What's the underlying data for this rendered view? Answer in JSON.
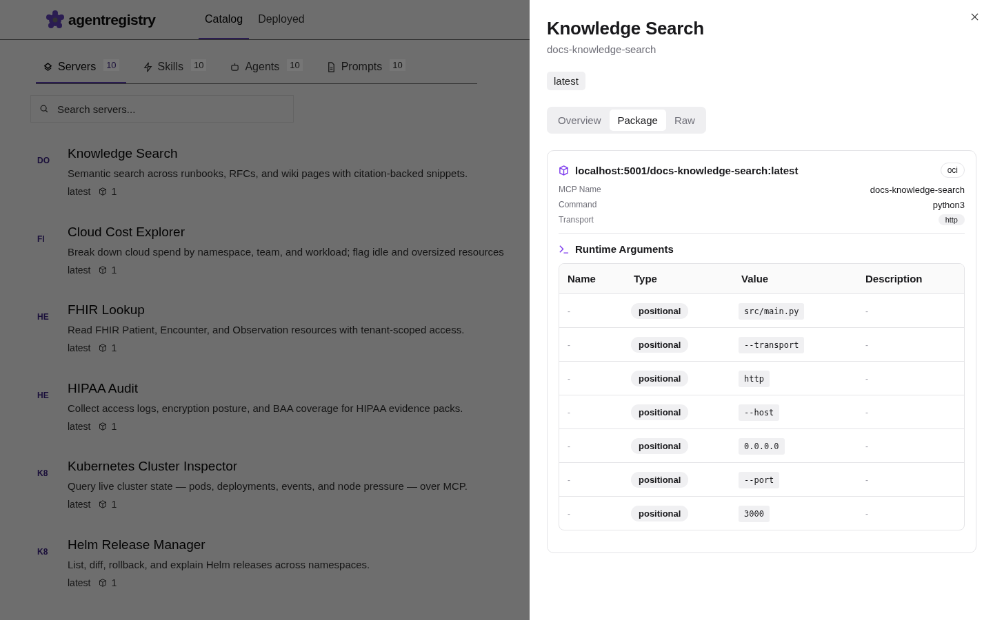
{
  "header": {
    "logo": "agentregistry",
    "nav": [
      {
        "label": "Catalog",
        "selected": true
      },
      {
        "label": "Deployed",
        "selected": false
      }
    ]
  },
  "catalog_tabs": [
    {
      "kind": "servers",
      "label": "Servers",
      "count": "10",
      "selected": true
    },
    {
      "kind": "skills",
      "label": "Skills",
      "count": "10",
      "selected": false
    },
    {
      "kind": "agents",
      "label": "Agents",
      "count": "10",
      "selected": false
    },
    {
      "kind": "prompts",
      "label": "Prompts",
      "count": "10",
      "selected": false
    }
  ],
  "search": {
    "placeholder": "Search servers..."
  },
  "servers": [
    {
      "initials": "DO",
      "name": "Knowledge Search",
      "description": "Semantic search across runbooks, RFCs, and wiki pages with citation-backed snippets.",
      "version": "latest",
      "packages": "1"
    },
    {
      "initials": "FI",
      "name": "Cloud Cost Explorer",
      "description": "Break down cloud spend by namespace, team, and workload; flag idle and oversized resources",
      "version": "latest",
      "packages": "1"
    },
    {
      "initials": "HE",
      "name": "FHIR Lookup",
      "description": "Read FHIR Patient, Encounter, and Observation resources with tenant-scoped access.",
      "version": "latest",
      "packages": "1"
    },
    {
      "initials": "HE",
      "name": "HIPAA Audit",
      "description": "Collect access logs, encryption posture, and BAA coverage for HIPAA evidence packs.",
      "version": "latest",
      "packages": "1"
    },
    {
      "initials": "K8",
      "name": "Kubernetes Cluster Inspector",
      "description": "Query live cluster state — pods, deployments, events, and node pressure — over MCP.",
      "version": "latest",
      "packages": "1"
    },
    {
      "initials": "K8",
      "name": "Helm Release Manager",
      "description": "List, diff, rollback, and explain Helm releases across namespaces.",
      "version": "latest",
      "packages": "1"
    }
  ],
  "drawer": {
    "title": "Knowledge Search",
    "subtitle": "docs-knowledge-search",
    "version_badge": "latest",
    "tabs": [
      {
        "label": "Overview",
        "selected": false
      },
      {
        "label": "Package",
        "selected": true
      },
      {
        "label": "Raw",
        "selected": false
      }
    ],
    "package": {
      "identifier": "localhost:5001/docs-knowledge-search:latest",
      "registry_type": "oci",
      "fields": [
        {
          "kind": "text",
          "label": "MCP Name",
          "value": "docs-knowledge-search"
        },
        {
          "kind": "text",
          "label": "Command",
          "value": "python3"
        },
        {
          "kind": "badge",
          "label": "Transport",
          "value": "http"
        }
      ],
      "runtime_arguments": {
        "title": "Runtime Arguments",
        "columns": [
          "Name",
          "Type",
          "Value",
          "Description"
        ],
        "rows": [
          {
            "name": "-",
            "type": "positional",
            "value": "src/main.py",
            "description": "-"
          },
          {
            "name": "-",
            "type": "positional",
            "value": "--transport",
            "description": "-"
          },
          {
            "name": "-",
            "type": "positional",
            "value": "http",
            "description": "-"
          },
          {
            "name": "-",
            "type": "positional",
            "value": "--host",
            "description": "-"
          },
          {
            "name": "-",
            "type": "positional",
            "value": "0.0.0.0",
            "description": "-"
          },
          {
            "name": "-",
            "type": "positional",
            "value": "--port",
            "description": "-"
          },
          {
            "name": "-",
            "type": "positional",
            "value": "3000",
            "description": "-"
          }
        ]
      }
    }
  }
}
